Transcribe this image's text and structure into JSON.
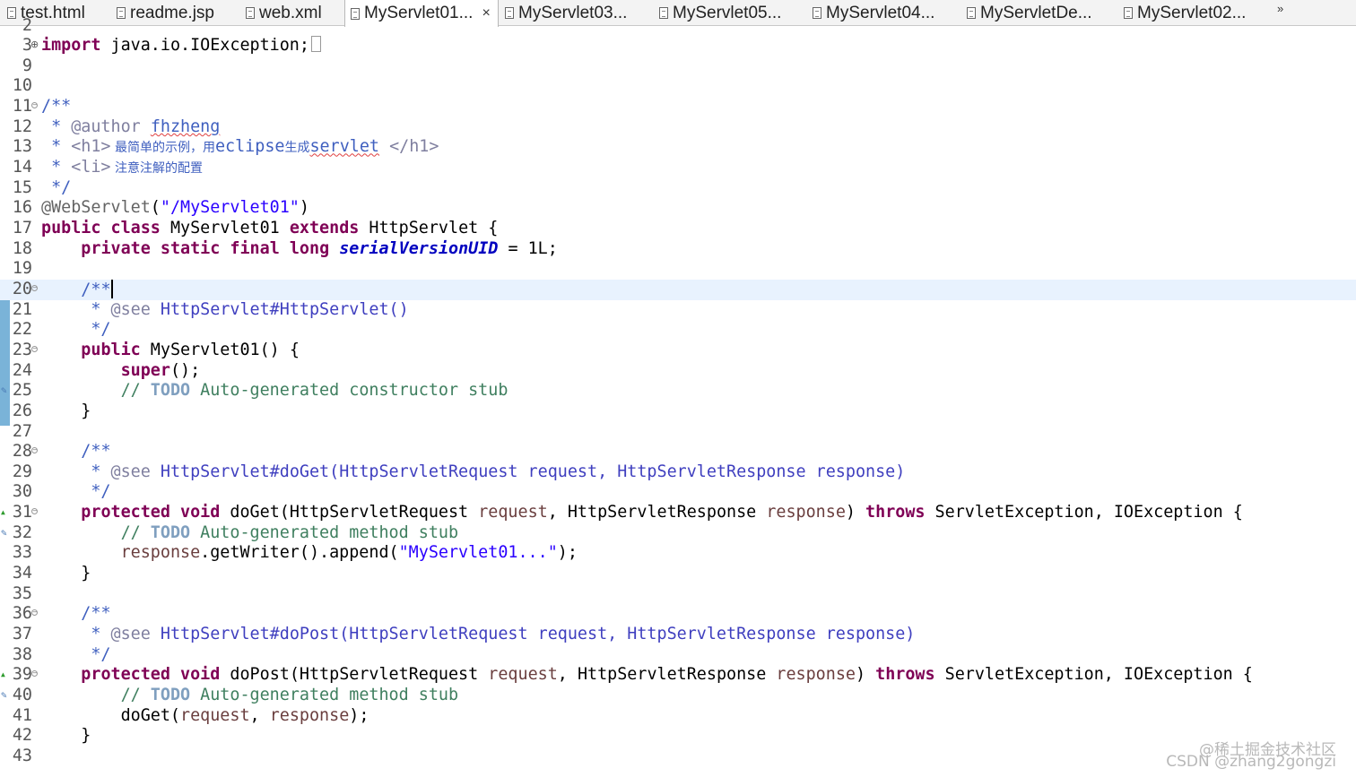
{
  "tabs": [
    {
      "label": "test.html",
      "active": false
    },
    {
      "label": "readme.jsp",
      "active": false
    },
    {
      "label": "web.xml",
      "active": false
    },
    {
      "label": "MyServlet01...",
      "active": true
    },
    {
      "label": "MyServlet03...",
      "active": false
    },
    {
      "label": "MyServlet05...",
      "active": false
    },
    {
      "label": "MyServlet04...",
      "active": false
    },
    {
      "label": "MyServletDe...",
      "active": false
    },
    {
      "label": "MyServlet02...",
      "active": false
    }
  ],
  "tab_overflow": "»",
  "close_glyph": "×",
  "code_lines": [
    {
      "n": "2",
      "segs": []
    },
    {
      "n": "3",
      "segs": [
        {
          "t": "import",
          "c": "kw"
        },
        {
          "t": " java.io.IOException;"
        }
      ]
    },
    {
      "n": "9",
      "segs": []
    },
    {
      "n": "10",
      "segs": []
    },
    {
      "n": "11",
      "segs": [
        {
          "t": "/**",
          "c": "cm"
        }
      ]
    },
    {
      "n": "12",
      "segs": [
        {
          "t": " * ",
          "c": "cm"
        },
        {
          "t": "@author",
          "c": "tag"
        },
        {
          "t": " ",
          "c": "cm"
        },
        {
          "t": "fhzheng",
          "c": "cm squig"
        }
      ]
    },
    {
      "n": "13",
      "segs": [
        {
          "t": " * ",
          "c": "cm"
        },
        {
          "t": "<h1>",
          "c": "tag"
        },
        {
          "t": " 最简单的示例，用",
          "c": "cm cjk"
        },
        {
          "t": "eclipse",
          "c": "cm"
        },
        {
          "t": "生成",
          "c": "cm cjk"
        },
        {
          "t": "servlet",
          "c": "cm squig"
        },
        {
          "t": " ",
          "c": "cm"
        },
        {
          "t": "</h1>",
          "c": "tag"
        }
      ]
    },
    {
      "n": "14",
      "segs": [
        {
          "t": " * ",
          "c": "cm"
        },
        {
          "t": "<li>",
          "c": "tag"
        },
        {
          "t": " 注意注解的配置",
          "c": "cm cjk"
        }
      ]
    },
    {
      "n": "15",
      "segs": [
        {
          "t": " */",
          "c": "cm"
        }
      ]
    },
    {
      "n": "16",
      "segs": [
        {
          "t": "@WebServlet",
          "c": "ann"
        },
        {
          "t": "("
        },
        {
          "t": "\"/MyServlet01\"",
          "c": "st"
        },
        {
          "t": ")"
        }
      ]
    },
    {
      "n": "17",
      "segs": [
        {
          "t": "public",
          "c": "kw"
        },
        {
          "t": " "
        },
        {
          "t": "class",
          "c": "kw"
        },
        {
          "t": " MyServlet01 "
        },
        {
          "t": "extends",
          "c": "kw"
        },
        {
          "t": " HttpServlet {"
        }
      ]
    },
    {
      "n": "18",
      "segs": [
        {
          "t": "    "
        },
        {
          "t": "private",
          "c": "kw"
        },
        {
          "t": " "
        },
        {
          "t": "static",
          "c": "kw"
        },
        {
          "t": " "
        },
        {
          "t": "final",
          "c": "kw"
        },
        {
          "t": " "
        },
        {
          "t": "long",
          "c": "kw"
        },
        {
          "t": " "
        },
        {
          "t": "serialVersionUID",
          "c": "fld"
        },
        {
          "t": " = 1L;"
        }
      ]
    },
    {
      "n": "19",
      "segs": []
    },
    {
      "n": "20",
      "segs": [
        {
          "t": "    "
        },
        {
          "t": "/**",
          "c": "cm"
        }
      ]
    },
    {
      "n": "21",
      "segs": [
        {
          "t": "     * ",
          "c": "cm"
        },
        {
          "t": "@see",
          "c": "tag"
        },
        {
          "t": " ",
          "c": "cm"
        },
        {
          "t": "HttpServlet#HttpServlet()",
          "c": "link"
        }
      ]
    },
    {
      "n": "22",
      "segs": [
        {
          "t": "     */",
          "c": "cm"
        }
      ]
    },
    {
      "n": "23",
      "segs": [
        {
          "t": "    "
        },
        {
          "t": "public",
          "c": "kw"
        },
        {
          "t": " MyServlet01() {"
        }
      ]
    },
    {
      "n": "24",
      "segs": [
        {
          "t": "        "
        },
        {
          "t": "super",
          "c": "kw"
        },
        {
          "t": "();"
        }
      ]
    },
    {
      "n": "25",
      "segs": [
        {
          "t": "        "
        },
        {
          "t": "// ",
          "c": "lc"
        },
        {
          "t": "TODO",
          "c": "todo"
        },
        {
          "t": " Auto-generated constructor stub",
          "c": "lc"
        }
      ]
    },
    {
      "n": "26",
      "segs": [
        {
          "t": "    }"
        }
      ]
    },
    {
      "n": "27",
      "segs": []
    },
    {
      "n": "28",
      "segs": [
        {
          "t": "    "
        },
        {
          "t": "/**",
          "c": "cm"
        }
      ]
    },
    {
      "n": "29",
      "segs": [
        {
          "t": "     * ",
          "c": "cm"
        },
        {
          "t": "@see",
          "c": "tag"
        },
        {
          "t": " ",
          "c": "cm"
        },
        {
          "t": "HttpServlet#doGet(HttpServletRequest request, HttpServletResponse response)",
          "c": "link"
        }
      ]
    },
    {
      "n": "30",
      "segs": [
        {
          "t": "     */",
          "c": "cm"
        }
      ]
    },
    {
      "n": "31",
      "segs": [
        {
          "t": "    "
        },
        {
          "t": "protected",
          "c": "kw"
        },
        {
          "t": " "
        },
        {
          "t": "void",
          "c": "kw"
        },
        {
          "t": " doGet(HttpServletRequest "
        },
        {
          "t": "request",
          "c": "param"
        },
        {
          "t": ", HttpServletResponse "
        },
        {
          "t": "response",
          "c": "param"
        },
        {
          "t": ") "
        },
        {
          "t": "throws",
          "c": "kw"
        },
        {
          "t": " ServletException, IOException {"
        }
      ]
    },
    {
      "n": "32",
      "segs": [
        {
          "t": "        "
        },
        {
          "t": "// ",
          "c": "lc"
        },
        {
          "t": "TODO",
          "c": "todo"
        },
        {
          "t": " Auto-generated method stub",
          "c": "lc"
        }
      ]
    },
    {
      "n": "33",
      "segs": [
        {
          "t": "        "
        },
        {
          "t": "response",
          "c": "param"
        },
        {
          "t": ".getWriter().append("
        },
        {
          "t": "\"MyServlet01...\"",
          "c": "st"
        },
        {
          "t": ");"
        }
      ]
    },
    {
      "n": "34",
      "segs": [
        {
          "t": "    }"
        }
      ]
    },
    {
      "n": "35",
      "segs": []
    },
    {
      "n": "36",
      "segs": [
        {
          "t": "    "
        },
        {
          "t": "/**",
          "c": "cm"
        }
      ]
    },
    {
      "n": "37",
      "segs": [
        {
          "t": "     * ",
          "c": "cm"
        },
        {
          "t": "@see",
          "c": "tag"
        },
        {
          "t": " ",
          "c": "cm"
        },
        {
          "t": "HttpServlet#doPost(HttpServletRequest request, HttpServletResponse response)",
          "c": "link"
        }
      ]
    },
    {
      "n": "38",
      "segs": [
        {
          "t": "     */",
          "c": "cm"
        }
      ]
    },
    {
      "n": "39",
      "segs": [
        {
          "t": "    "
        },
        {
          "t": "protected",
          "c": "kw"
        },
        {
          "t": " "
        },
        {
          "t": "void",
          "c": "kw"
        },
        {
          "t": " doPost(HttpServletRequest "
        },
        {
          "t": "request",
          "c": "param"
        },
        {
          "t": ", HttpServletResponse "
        },
        {
          "t": "response",
          "c": "param"
        },
        {
          "t": ") "
        },
        {
          "t": "throws",
          "c": "kw"
        },
        {
          "t": " ServletException, IOException {"
        }
      ]
    },
    {
      "n": "40",
      "segs": [
        {
          "t": "        "
        },
        {
          "t": "// ",
          "c": "lc"
        },
        {
          "t": "TODO",
          "c": "todo"
        },
        {
          "t": " Auto-generated method stub",
          "c": "lc"
        }
      ]
    },
    {
      "n": "41",
      "segs": [
        {
          "t": "        doGet("
        },
        {
          "t": "request",
          "c": "param"
        },
        {
          "t": ", "
        },
        {
          "t": "response",
          "c": "param"
        },
        {
          "t": ");"
        }
      ]
    },
    {
      "n": "42",
      "segs": [
        {
          "t": "    }"
        }
      ]
    },
    {
      "n": "43",
      "segs": []
    }
  ],
  "watermark": {
    "line1": "@稀土掘金技术社区",
    "line2": "CSDN @zhang2gongzi"
  },
  "colors": {
    "keyword": "#7f0055",
    "javadoc": "#3f5fbf",
    "line_comment": "#3f7f5f",
    "string": "#2a00ff",
    "current_line": "#e8f2fe"
  }
}
